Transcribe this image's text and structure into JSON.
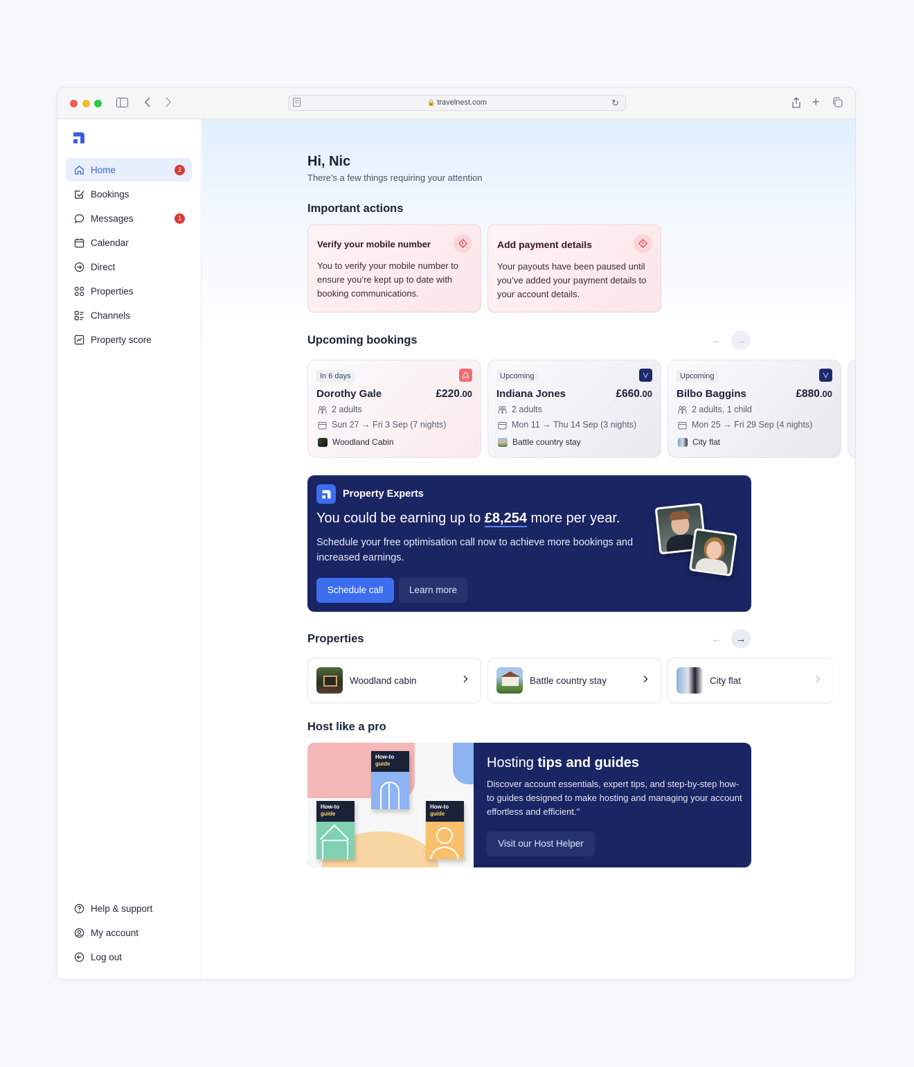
{
  "browser": {
    "url": "travelnest.com"
  },
  "sidebar": {
    "items": [
      {
        "label": "Home",
        "badge": "2",
        "icon": "home-icon"
      },
      {
        "label": "Bookings",
        "icon": "checklist-icon"
      },
      {
        "label": "Messages",
        "badge": "1",
        "icon": "chat-bubble-icon"
      },
      {
        "label": "Calendar",
        "icon": "calendar-icon"
      },
      {
        "label": "Direct",
        "icon": "arrow-circle-icon"
      },
      {
        "label": "Properties",
        "icon": "grid-icon"
      },
      {
        "label": "Channels",
        "icon": "channels-icon"
      },
      {
        "label": "Property score",
        "icon": "chart-icon"
      }
    ],
    "footer": [
      {
        "label": "Help & support",
        "icon": "help-icon"
      },
      {
        "label": "My account",
        "icon": "account-icon"
      },
      {
        "label": "Log out",
        "icon": "logout-icon"
      }
    ]
  },
  "greeting": {
    "title": "Hi, Nic",
    "subtitle": "There's a few things requiring your attention"
  },
  "important_actions": {
    "heading": "Important actions",
    "cards": [
      {
        "title": "Verify your mobile number",
        "body": "You to verify your mobile number to ensure you’re kept up to date with booking communications."
      },
      {
        "title": "Add payment details",
        "body": "Your payouts have been paused until you’ve added your payment details to your account details."
      }
    ]
  },
  "upcoming_bookings": {
    "heading": "Upcoming bookings",
    "cards": [
      {
        "tag": "In 6 days",
        "guest": "Dorothy Gale",
        "price_main": "£220",
        "price_cents": ".00",
        "guests": "2 adults",
        "dates": "Sun 27 → Fri 3 Sep (7 nights)",
        "property": "Woodland Cabin",
        "channel": "airbnb"
      },
      {
        "tag": "Upcoming",
        "guest": "Indiana Jones",
        "price_main": "£660",
        "price_cents": ".00",
        "guests": "2 adults",
        "dates": "Mon 11 → Thu 14 Sep (3 nights)",
        "property": "Battle country stay",
        "channel": "vrbo"
      },
      {
        "tag": "Upcoming",
        "guest": "Bilbo Baggins",
        "price_main": "£880",
        "price_cents": ".00",
        "guests": "2 adults, 1 child",
        "dates": "Mon 25 → Fri 29 Sep (4 nights)",
        "property": "City flat",
        "channel": "vrbo"
      }
    ]
  },
  "promo": {
    "brand": "Property Experts",
    "headline_pre": "You could be earning up to ",
    "headline_amount": "£8,254",
    "headline_post": " more per year.",
    "body": "Schedule your free optimisation call now to achieve more bookings and increased earnings.",
    "primary_button": "Schedule call",
    "secondary_button": "Learn more"
  },
  "properties": {
    "heading": "Properties",
    "items": [
      {
        "name": "Woodland cabin"
      },
      {
        "name": "Battle country stay"
      },
      {
        "name": "City flat"
      }
    ]
  },
  "host_pro": {
    "heading": "Host like a pro",
    "title_light": "Hosting ",
    "title_bold": "tips and guides",
    "body": "Discover account essentials, expert tips, and step-by-step how-to guides designed to make hosting and managing your account effortless and efficient.\"",
    "button": "Visit our Host Helper",
    "book_label_line1": "How-to",
    "book_label_line2": "guide"
  },
  "colors": {
    "accent": "#3d6ef0",
    "navy": "#1a2563",
    "badge": "#d93a3a"
  }
}
